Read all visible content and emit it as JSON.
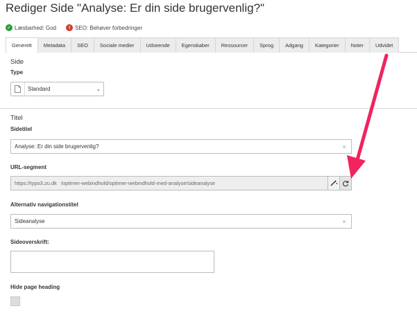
{
  "page": {
    "title": "Rediger Side \"Analyse: Er din side brugervenlig?\""
  },
  "status": {
    "readability": {
      "label": "Læsbarhed: God",
      "color": "#2e9d3a",
      "icon": "check-icon"
    },
    "seo": {
      "label": "SEO: Behøver forbedringer",
      "color": "#d23b2e",
      "icon": "warning-icon"
    }
  },
  "tabs": [
    {
      "label": "Generelt",
      "active": true
    },
    {
      "label": "Metadata"
    },
    {
      "label": "SEO"
    },
    {
      "label": "Sociale medier"
    },
    {
      "label": "Udseende"
    },
    {
      "label": "Egenskaber"
    },
    {
      "label": "Ressourcer"
    },
    {
      "label": "Sprog"
    },
    {
      "label": "Adgang"
    },
    {
      "label": "Kategorier"
    },
    {
      "label": "Noter"
    },
    {
      "label": "Udvidet"
    }
  ],
  "sections": {
    "side": {
      "heading": "Side",
      "type_label": "Type",
      "type_value": "Standard"
    },
    "titel": {
      "heading": "Titel",
      "sidetitel_label": "Sidetitel",
      "sidetitel_value": "Analyse: Er din side brugervenlig?",
      "url_label": "URL-segment",
      "url_prefix": "https://typo3.zu.dk",
      "url_value": "/optimer-webindhold/optimer-webindhold-med-analyse/sideanalyse",
      "altnav_label": "Alternativ navigationstitel",
      "altnav_value": "Sideanalyse",
      "sideoverskrift_label": "Sideoverskrift:",
      "sideoverskrift_value": "",
      "hide_heading_label": "Hide page heading"
    }
  },
  "colors": {
    "arrow": "#f0245e"
  }
}
